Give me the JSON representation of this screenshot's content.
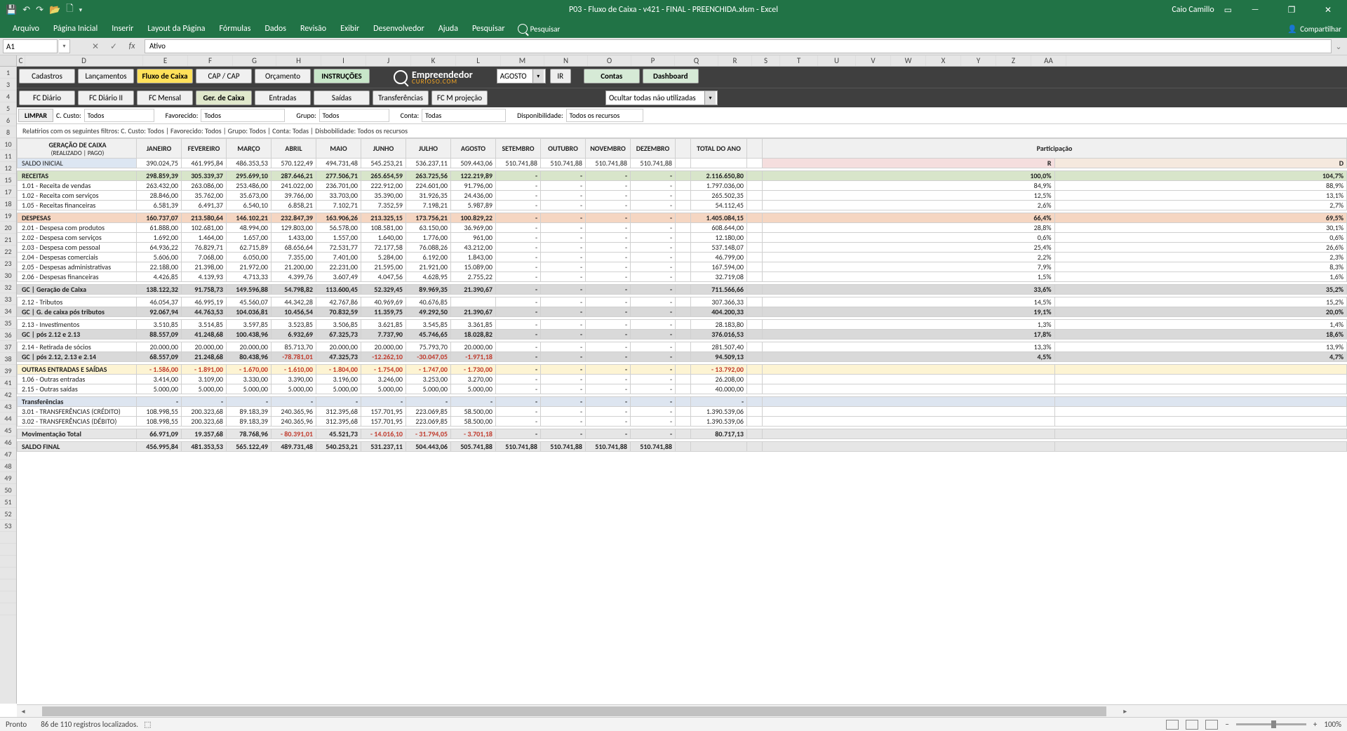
{
  "app": {
    "title": "P03 - Fluxo de Caixa - v421 - FINAL - PREENCHIDA.xlsm  -  Excel",
    "user": "Caio Camillo"
  },
  "ribbon": {
    "tabs": [
      "Arquivo",
      "Página Inicial",
      "Inserir",
      "Layout da Página",
      "Fórmulas",
      "Dados",
      "Revisão",
      "Exibir",
      "Desenvolvedor",
      "Ajuda",
      "Pesquisar"
    ],
    "tell": "Pesquisar",
    "share": "Compartilhar"
  },
  "fbar": {
    "cell": "A1",
    "value": "Ativo"
  },
  "cols": [
    "C",
    "D",
    "E",
    "F",
    "G",
    "H",
    "I",
    "J",
    "K",
    "L",
    "M",
    "N",
    "O",
    "P",
    "Q",
    "R",
    "S",
    "T",
    "U",
    "V",
    "W",
    "X",
    "Y",
    "Z",
    "AA"
  ],
  "nav": {
    "row1": [
      "Cadastros",
      "Lançamentos",
      "Fluxo de Caixa",
      "CAP / CAP",
      "Orçamento",
      "INSTRUÇÕES"
    ],
    "row1b": [
      "Contas",
      "Dashboard"
    ],
    "row2": [
      "FC Diário",
      "FC Diário II",
      "FC Mensal",
      "Ger. de Caixa",
      "Entradas",
      "Saídas",
      "Transferências",
      "FC M projeção"
    ],
    "dd1": "AGOSTO",
    "ir": "IR",
    "dd2": "Ocultar todas não utilizadas"
  },
  "filters": {
    "limpar": "LIMPAR",
    "ccusto_l": "C. Custo:",
    "ccusto": "Todos",
    "fav_l": "Favorecido:",
    "fav": "Todos",
    "grp_l": "Grupo:",
    "grp": "Todos",
    "cta_l": "Conta:",
    "cta": "Todas",
    "dis_l": "Disponibilidade:",
    "dis": "Todos os recursos",
    "note": "Relatírios com os seguintes filtros: C. Custo: Todos | Favorecido: Todos | Grupo: Todos | Conta: Todas | Disbobilidade: Todos os recursos"
  },
  "hdr": {
    "gc": "GERAÇÃO DE CAIXA",
    "sub": "(REALIZADO | PAGO)",
    "months": [
      "JANEIRO",
      "FEVEREIRO",
      "MARÇO",
      "ABRIL",
      "MAIO",
      "JUNHO",
      "JULHO",
      "AGOSTO",
      "SETEMBRO",
      "OUTUBRO",
      "NOVEMBRO",
      "DEZEMBRO"
    ],
    "total": "TOTAL DO ANO",
    "part": "Participação",
    "R": "R",
    "D": "D"
  },
  "rows": [
    {
      "k": "si",
      "cls": "hdrblue",
      "lbl": "SALDO INICIAL",
      "v": [
        "390.024,75",
        "461.995,84",
        "486.353,53",
        "570.122,49",
        "494.731,48",
        "545.253,21",
        "536.237,11",
        "509.443,06",
        "510.741,88",
        "510.741,88",
        "510.741,88",
        "510.741,88"
      ],
      "t": "",
      "p1": "",
      "p2": ""
    },
    {
      "k": "rc",
      "cls": "grn",
      "lbl": "RECEITAS",
      "v": [
        "298.859,39",
        "305.339,37",
        "295.699,10",
        "287.646,21",
        "277.506,71",
        "265.654,59",
        "263.725,56",
        "122.219,89",
        "-",
        "-",
        "-",
        "-"
      ],
      "t": "2.116.650,80",
      "p1": "100,0%",
      "p2": "104,7%"
    },
    {
      "k": "r1",
      "lbl": "1.01 - Receita de vendas",
      "v": [
        "263.432,00",
        "263.086,00",
        "253.486,00",
        "241.022,00",
        "236.701,00",
        "222.912,00",
        "224.601,00",
        "91.796,00",
        "-",
        "-",
        "-",
        "-"
      ],
      "t": "1.797.036,00",
      "p1": "84,9%",
      "p2": "88,9%"
    },
    {
      "k": "r2",
      "lbl": "1.02 - Receita com serviços",
      "v": [
        "28.846,00",
        "35.762,00",
        "35.673,00",
        "39.766,00",
        "33.703,00",
        "35.390,00",
        "31.926,35",
        "24.436,00",
        "-",
        "-",
        "-",
        "-"
      ],
      "t": "265.502,35",
      "p1": "12,5%",
      "p2": "13,1%"
    },
    {
      "k": "r5",
      "lbl": "1.05 - Receitas financeiras",
      "v": [
        "6.581,39",
        "6.491,37",
        "6.540,10",
        "6.858,21",
        "7.102,71",
        "7.352,59",
        "7.198,21",
        "5.987,89",
        "-",
        "-",
        "-",
        "-"
      ],
      "t": "54.112,45",
      "p1": "2,6%",
      "p2": "2,7%"
    },
    {
      "k": "dp",
      "cls": "org",
      "lbl": "DESPESAS",
      "v": [
        "160.737,07",
        "213.580,64",
        "146.102,21",
        "232.847,39",
        "163.906,26",
        "213.325,15",
        "173.756,21",
        "100.829,22",
        "-",
        "-",
        "-",
        "-"
      ],
      "t": "1.405.084,15",
      "p1": "66,4%",
      "p2": "69,5%"
    },
    {
      "k": "d1",
      "lbl": "2.01 - Despesa com produtos",
      "v": [
        "61.888,00",
        "102.681,00",
        "48.994,00",
        "129.803,00",
        "56.578,00",
        "108.581,00",
        "63.150,00",
        "36.969,00",
        "-",
        "-",
        "-",
        "-"
      ],
      "t": "608.644,00",
      "p1": "28,8%",
      "p2": "30,1%"
    },
    {
      "k": "d2",
      "lbl": "2.02 - Despesa com serviços",
      "v": [
        "1.692,00",
        "1.464,00",
        "1.657,00",
        "1.433,00",
        "1.557,00",
        "1.640,00",
        "1.776,00",
        "961,00",
        "-",
        "-",
        "-",
        "-"
      ],
      "t": "12.180,00",
      "p1": "0,6%",
      "p2": "0,6%"
    },
    {
      "k": "d3",
      "lbl": "2.03 - Despesa com pessoal",
      "v": [
        "64.936,22",
        "76.829,71",
        "62.715,89",
        "68.656,64",
        "72.531,77",
        "72.177,58",
        "76.088,26",
        "43.212,00",
        "-",
        "-",
        "-",
        "-"
      ],
      "t": "537.148,07",
      "p1": "25,4%",
      "p2": "26,6%"
    },
    {
      "k": "d4",
      "lbl": "2.04 - Despesas comerciais",
      "v": [
        "5.606,00",
        "7.068,00",
        "6.050,00",
        "7.355,00",
        "7.401,00",
        "5.284,00",
        "6.192,00",
        "1.843,00",
        "-",
        "-",
        "-",
        "-"
      ],
      "t": "46.799,00",
      "p1": "2,2%",
      "p2": "2,3%"
    },
    {
      "k": "d5",
      "lbl": "2.05 - Despesas administrativas",
      "v": [
        "22.188,00",
        "21.398,00",
        "21.972,00",
        "21.200,00",
        "22.231,00",
        "21.595,00",
        "21.921,00",
        "15.089,00",
        "-",
        "-",
        "-",
        "-"
      ],
      "t": "167.594,00",
      "p1": "7,9%",
      "p2": "8,3%"
    },
    {
      "k": "d6",
      "lbl": "2.06 - Despesas financeiras",
      "v": [
        "4.426,85",
        "4.139,93",
        "4.713,33",
        "4.399,76",
        "3.607,49",
        "4.047,56",
        "4.628,95",
        "2.755,22",
        "-",
        "-",
        "-",
        "-"
      ],
      "t": "32.719,08",
      "p1": "1,5%",
      "p2": "1,6%"
    },
    {
      "k": "gc1",
      "cls": "gry",
      "lbl": "GC | Geração de Caixa",
      "v": [
        "138.122,32",
        "91.758,73",
        "149.596,88",
        "54.798,82",
        "113.600,45",
        "52.329,45",
        "89.969,35",
        "21.390,67",
        "-",
        "-",
        "-",
        "-"
      ],
      "t": "711.566,66",
      "p1": "33,6%",
      "p2": "35,2%"
    },
    {
      "k": "tb",
      "lbl": "2.12 - Tributos",
      "v": [
        "46.054,37",
        "46.995,19",
        "45.560,07",
        "44.342,28",
        "42.767,86",
        "40.969,69",
        "40.676,85",
        "",
        "-",
        "-",
        "-",
        "-"
      ],
      "t": "307.366,33",
      "p1": "14,5%",
      "p2": "15,2%"
    },
    {
      "k": "gc2",
      "cls": "gry",
      "lbl": "GC | G. de caixa pós tributos",
      "v": [
        "92.067,94",
        "44.763,53",
        "104.036,81",
        "10.456,54",
        "70.832,59",
        "11.359,75",
        "49.292,50",
        "21.390,67",
        "-",
        "-",
        "-",
        "-"
      ],
      "t": "404.200,33",
      "p1": "19,1%",
      "p2": "20,0%"
    },
    {
      "k": "inv",
      "lbl": "2.13 - Investimentos",
      "v": [
        "3.510,85",
        "3.514,85",
        "3.597,85",
        "3.523,85",
        "3.506,85",
        "3.621,85",
        "3.545,85",
        "3.361,85",
        "-",
        "-",
        "-",
        "-"
      ],
      "t": "28.183,80",
      "p1": "1,3%",
      "p2": "1,4%"
    },
    {
      "k": "gc3",
      "cls": "gry",
      "lbl": "GC | pós 2.12 e 2.13",
      "v": [
        "88.557,09",
        "41.248,68",
        "100.438,96",
        "6.932,69",
        "67.325,73",
        "7.737,90",
        "45.746,65",
        "18.028,82",
        "-",
        "-",
        "-",
        "-"
      ],
      "t": "376.016,53",
      "p1": "17,8%",
      "p2": "18,6%"
    },
    {
      "k": "rs",
      "lbl": "2.14 - Retirada de sócios",
      "v": [
        "20.000,00",
        "20.000,00",
        "20.000,00",
        "85.713,70",
        "20.000,00",
        "20.000,00",
        "75.793,70",
        "20.000,00",
        "-",
        "-",
        "-",
        "-"
      ],
      "t": "281.507,40",
      "p1": "13,3%",
      "p2": "13,9%"
    },
    {
      "k": "gc4",
      "cls": "gry",
      "lbl": "GC | pós 2.12, 2.13 e 2.14",
      "v": [
        "68.557,09",
        "21.248,68",
        "80.438,96",
        "-78.781,01",
        "47.325,73",
        "-12.262,10",
        "-30.047,05",
        "-1.971,18",
        "-",
        "-",
        "-",
        "-"
      ],
      "t": "94.509,13",
      "p1": "4,5%",
      "p2": "4,7%"
    },
    {
      "k": "oe",
      "cls": "yel",
      "lbl": "OUTRAS ENTRADAS E SAÍDAS",
      "v": [
        "- 1.586,00",
        "- 1.891,00",
        "- 1.670,00",
        "- 1.610,00",
        "- 1.804,00",
        "- 1.754,00",
        "- 1.747,00",
        "- 1.730,00",
        "-",
        "-",
        "-",
        "-"
      ],
      "t": "- 13.792,00",
      "p1": "",
      "p2": ""
    },
    {
      "k": "oe1",
      "lbl": "1.06 - Outras entradas",
      "v": [
        "3.414,00",
        "3.109,00",
        "3.330,00",
        "3.390,00",
        "3.196,00",
        "3.246,00",
        "3.253,00",
        "3.270,00",
        "-",
        "-",
        "-",
        "-"
      ],
      "t": "26.208,00",
      "p1": "",
      "p2": ""
    },
    {
      "k": "oe2",
      "lbl": "2.15 - Outras saídas",
      "v": [
        "5.000,00",
        "5.000,00",
        "5.000,00",
        "5.000,00",
        "5.000,00",
        "5.000,00",
        "5.000,00",
        "5.000,00",
        "-",
        "-",
        "-",
        "-"
      ],
      "t": "40.000,00",
      "p1": "",
      "p2": ""
    },
    {
      "k": "tr",
      "cls": "blu",
      "lbl": "Transferências",
      "v": [
        "-",
        "-",
        "-",
        "-",
        "-",
        "-",
        "-",
        "-",
        "-",
        "-",
        "-",
        "-"
      ],
      "t": "-",
      "p1": "",
      "p2": ""
    },
    {
      "k": "tr1",
      "lbl": "3.01 - TRANSFERÊNCIAS (CRÉDITO)",
      "v": [
        "108.998,55",
        "200.323,68",
        "89.183,39",
        "240.365,96",
        "312.395,68",
        "157.701,95",
        "223.069,85",
        "58.500,00",
        "-",
        "-",
        "-",
        "-"
      ],
      "t": "1.390.539,06",
      "p1": "",
      "p2": ""
    },
    {
      "k": "tr2",
      "lbl": "3.02 - TRANSFERÊNCIAS (DÉBITO)",
      "v": [
        "108.998,55",
        "200.323,68",
        "89.183,39",
        "240.365,96",
        "312.395,68",
        "157.701,95",
        "223.069,85",
        "58.500,00",
        "-",
        "-",
        "-",
        "-"
      ],
      "t": "1.390.539,06",
      "p1": "",
      "p2": ""
    },
    {
      "k": "mt",
      "cls": "gry2",
      "lbl": "Movimentação Total",
      "v": [
        "66.971,09",
        "19.357,68",
        "78.768,96",
        "- 80.391,01",
        "45.521,73",
        "- 14.016,10",
        "- 31.794,05",
        "- 3.701,18",
        "-",
        "-",
        "-",
        "-"
      ],
      "t": "80.717,13",
      "p1": "",
      "p2": ""
    },
    {
      "k": "sf",
      "cls": "gry2",
      "lbl": "SALDO FINAL",
      "v": [
        "456.995,84",
        "481.353,53",
        "565.122,49",
        "489.731,48",
        "540.253,21",
        "531.237,11",
        "504.443,06",
        "505.741,88",
        "510.741,88",
        "510.741,88",
        "510.741,88",
        "510.741,88"
      ],
      "t": "",
      "p1": "",
      "p2": ""
    }
  ],
  "status": {
    "ready": "Pronto",
    "rec": "86 de 110 registros localizados.",
    "zoom": "100%"
  },
  "rownums": [
    1,
    3,
    4,
    5,
    6,
    8,
    10,
    11,
    12,
    15,
    17,
    18,
    19,
    20,
    21,
    22,
    23,
    30,
    32,
    33,
    34,
    35,
    36,
    37,
    38,
    39,
    41,
    42,
    43,
    44,
    45,
    46,
    47,
    48,
    49,
    50,
    51,
    52,
    53
  ]
}
